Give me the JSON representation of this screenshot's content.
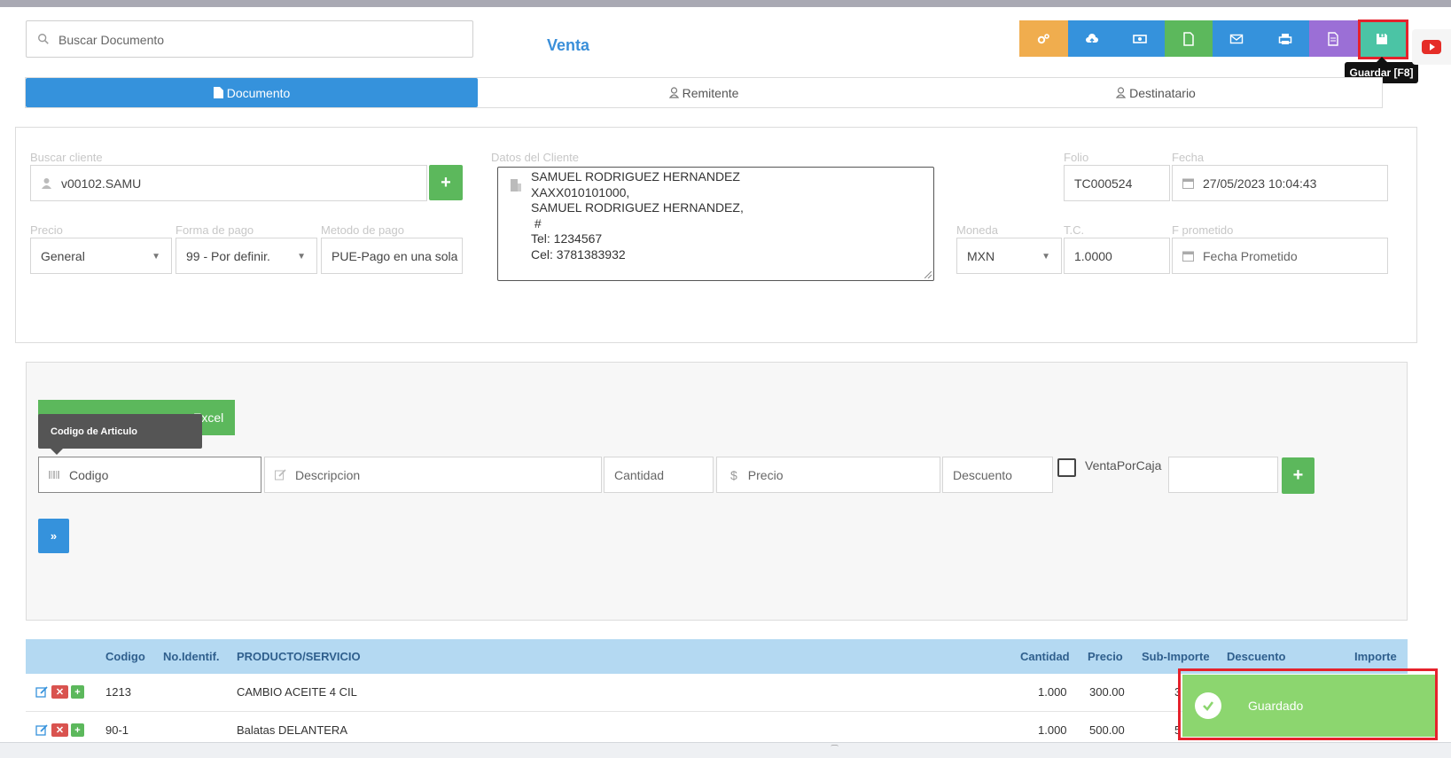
{
  "search": {
    "placeholder": "Buscar Documento"
  },
  "page_title": "Venta",
  "toolbar": {
    "buttons": [
      {
        "name": "settings",
        "color": "#f0ad4e",
        "icon": "cogs-icon"
      },
      {
        "name": "cloud",
        "color": "#3592dc",
        "icon": "cloud-upload-icon"
      },
      {
        "name": "cash",
        "color": "#3592dc",
        "icon": "money-icon"
      },
      {
        "name": "file",
        "color": "#5cb85c",
        "icon": "file-icon"
      },
      {
        "name": "email",
        "color": "#3592dc",
        "icon": "envelope-icon"
      },
      {
        "name": "print",
        "color": "#3592dc",
        "icon": "print-icon"
      },
      {
        "name": "document",
        "color": "#9b6fd6",
        "icon": "document-icon"
      },
      {
        "name": "save",
        "color": "#4bc4a5",
        "icon": "floppy-icon"
      }
    ],
    "save_tooltip": "Guardar [F8]"
  },
  "tabs": [
    {
      "label": "Documento",
      "active": true
    },
    {
      "label": "Remitente",
      "active": false
    },
    {
      "label": "Destinatario",
      "active": false
    }
  ],
  "form": {
    "buscar_cliente_label": "Buscar cliente",
    "cliente_value": "v00102.SAMU",
    "datos_cliente_label": "Datos del Cliente",
    "datos_cliente_lines": [
      "SAMUEL RODRIGUEZ HERNANDEZ",
      "XAXX010101000,",
      "SAMUEL RODRIGUEZ HERNANDEZ,",
      " #",
      "Tel: 1234567",
      "Cel: 3781383932"
    ],
    "folio_label": "Folio",
    "folio_value": "TC000524",
    "fecha_label": "Fecha",
    "fecha_value": "27/05/2023 10:04:43",
    "precio_label": "Precio",
    "precio_value": "General",
    "forma_pago_label": "Forma de pago",
    "forma_pago_value": "99 - Por definir.",
    "metodo_pago_label": "Metodo de pago",
    "metodo_pago_value": "PUE-Pago en una sola",
    "moneda_label": "Moneda",
    "moneda_value": "MXN",
    "tc_label": "T.C.",
    "tc_value": "1.0000",
    "fprometido_label": "F prometido",
    "fprometido_placeholder": "Fecha Prometido"
  },
  "items_form": {
    "excel_button": "Excel",
    "codigo_tooltip": "Codigo de Articulo",
    "codigo_placeholder": "Codigo",
    "descripcion_placeholder": "Descripcion",
    "cantidad_placeholder": "Cantidad",
    "precio_placeholder": "Precio",
    "descuento_placeholder": "Descuento",
    "venta_por_caja_label": "VentaPorCaja",
    "next_button": "»"
  },
  "table": {
    "headers": {
      "codigo": "Codigo",
      "no_identif": "No.Identif.",
      "producto": "PRODUCTO/SERVICIO",
      "cantidad": "Cantidad",
      "precio": "Precio",
      "sub_importe": "Sub-Importe",
      "descuento": "Descuento",
      "importe": "Importe"
    },
    "rows": [
      {
        "codigo": "1213",
        "producto": "CAMBIO ACEITE 4 CIL",
        "cantidad": "1.000",
        "precio": "300.00",
        "sub_importe_visible": "3"
      },
      {
        "codigo": "90-1",
        "producto": "Balatas DELANTERA",
        "cantidad": "1.000",
        "precio": "500.00",
        "sub_importe_visible": "5"
      }
    ]
  },
  "toast": {
    "message": "Guardado"
  }
}
